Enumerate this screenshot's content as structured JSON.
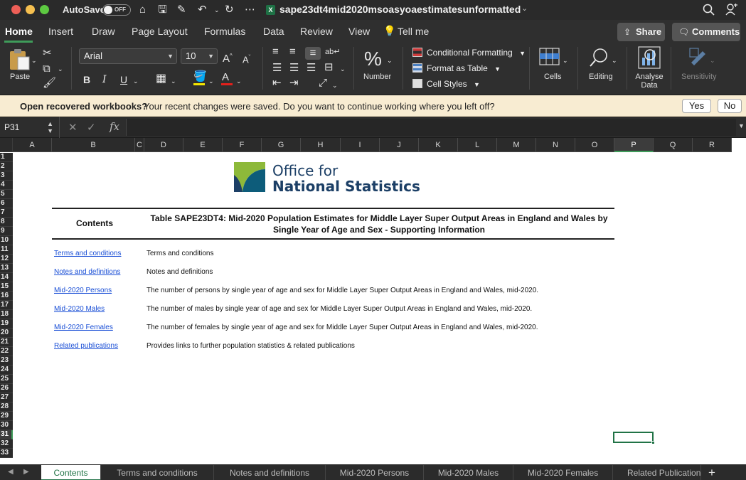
{
  "window": {
    "autosave_label": "AutoSave",
    "autosave_state": "OFF",
    "doc_title": "sape23dt4mid2020msoasyoaestimatesunformatted",
    "file_badge": "X"
  },
  "ribbon_tabs": [
    "Home",
    "Insert",
    "Draw",
    "Page Layout",
    "Formulas",
    "Data",
    "Review",
    "View",
    "Tell me"
  ],
  "header_buttons": {
    "share": "Share",
    "comments": "Comments"
  },
  "ribbon": {
    "paste_label": "Paste",
    "font_name": "Arial",
    "font_size": "10",
    "number_label": "Number",
    "number_icon": "%",
    "conditional_formatting": "Conditional Formatting",
    "format_as_table": "Format as Table",
    "cell_styles": "Cell Styles",
    "cells_label": "Cells",
    "editing_label": "Editing",
    "analyse_label_1": "Analyse",
    "analyse_label_2": "Data",
    "sensitivity_label": "Sensitivity",
    "bold": "B",
    "italic": "I",
    "underline": "U"
  },
  "message_bar": {
    "title": "Open recovered workbooks?",
    "text": "Your recent changes were saved. Do you want to continue working where you left off?",
    "yes": "Yes",
    "no": "No"
  },
  "formula_bar": {
    "name_box": "P31",
    "formula": "",
    "fx": "fx"
  },
  "columns": [
    "A",
    "B",
    "C",
    "D",
    "E",
    "F",
    "G",
    "H",
    "I",
    "J",
    "K",
    "L",
    "M",
    "N",
    "O",
    "P",
    "Q",
    "R"
  ],
  "selected_column": "P",
  "rows": [
    "1",
    "2",
    "3",
    "4",
    "5",
    "6",
    "7",
    "8",
    "9",
    "10",
    "11",
    "12",
    "13",
    "14",
    "15",
    "16",
    "17",
    "18",
    "19",
    "20",
    "21",
    "22",
    "23",
    "24",
    "25",
    "26",
    "27",
    "28",
    "29",
    "30",
    "31",
    "32",
    "33"
  ],
  "selected_row": "31",
  "sheet": {
    "logo_line1": "Office for",
    "logo_line2": "National Statistics",
    "contents_header": "Contents",
    "table_title": "Table SAPE23DT4: Mid-2020 Population Estimates for Middle Layer Super Output Areas in England and Wales by Single Year of Age and Sex - Supporting Information",
    "entries": [
      {
        "link": "Terms and conditions",
        "desc": "Terms and conditions"
      },
      {
        "link": "Notes and definitions",
        "desc": "Notes and definitions"
      },
      {
        "link": "Mid-2020 Persons",
        "desc": "The number of persons by single year of age and sex for Middle Layer Super Output Areas in England and Wales, mid-2020."
      },
      {
        "link": "Mid-2020 Males",
        "desc": "The number of males by single year of age and sex for Middle Layer Super Output Areas in England and Wales, mid-2020."
      },
      {
        "link": "Mid-2020 Females",
        "desc": "The number of females by single year of age and sex for Middle Layer Super Output Areas in England and Wales, mid-2020."
      },
      {
        "link": "Related publications",
        "desc": "Provides links to further population statistics & related publications"
      }
    ]
  },
  "sheet_tabs": [
    "Contents",
    "Terms and conditions",
    "Notes and definitions",
    "Mid-2020 Persons",
    "Mid-2020 Males",
    "Mid-2020 Females",
    "Related Publications"
  ],
  "active_sheet": "Contents",
  "colors": {
    "accent": "#217346",
    "link": "#1a4fd6",
    "ons_navy": "#1c3f66",
    "message_bg": "#f8ecd2"
  }
}
